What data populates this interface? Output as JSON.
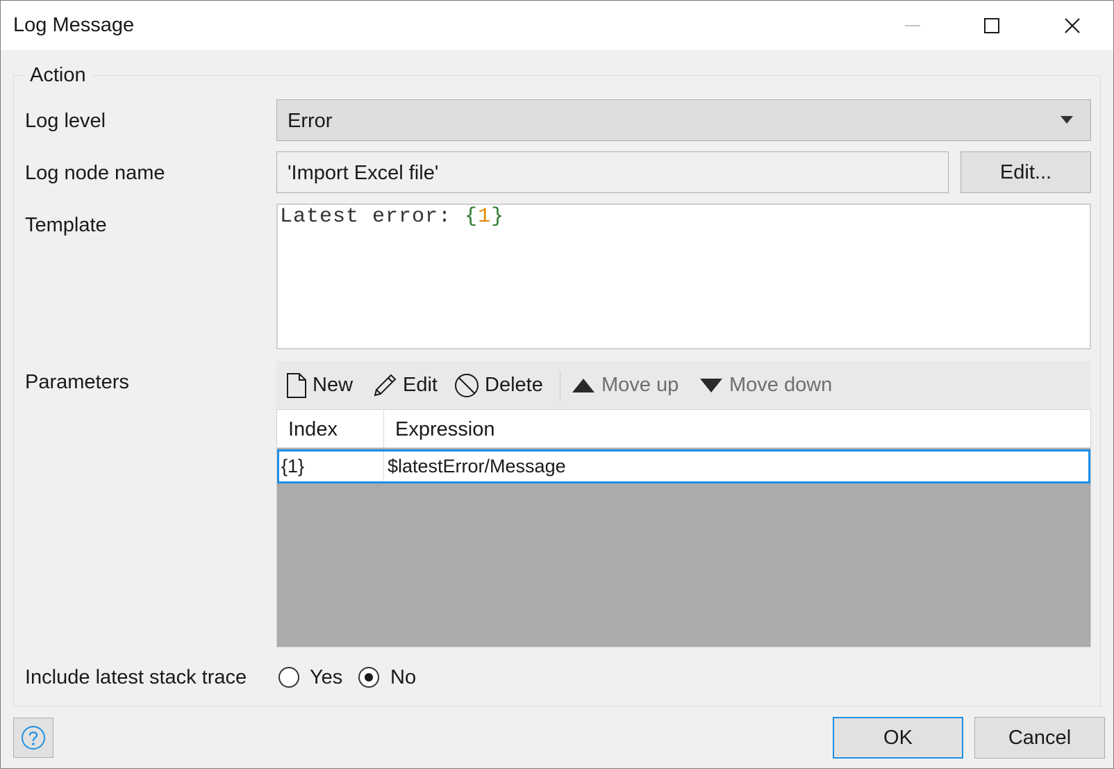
{
  "window": {
    "title": "Log Message"
  },
  "action_group": {
    "legend": "Action"
  },
  "log_level": {
    "label": "Log level",
    "value": "Error"
  },
  "log_node": {
    "label": "Log node name",
    "value": "'Import Excel file'",
    "edit_label": "Edit..."
  },
  "template": {
    "label": "Template",
    "text_prefix": "Latest error: ",
    "open_brace": "{",
    "param_index": "1",
    "close_brace": "}"
  },
  "parameters": {
    "label": "Parameters",
    "toolbar": {
      "new_label": "New",
      "edit_label": "Edit",
      "delete_label": "Delete",
      "move_up_label": "Move up",
      "move_down_label": "Move down"
    },
    "columns": {
      "index": "Index",
      "expression": "Expression"
    },
    "rows": [
      {
        "index": "{1}",
        "expression": "$latestError/Message"
      }
    ]
  },
  "stack_trace": {
    "label": "Include latest stack trace",
    "yes_label": "Yes",
    "no_label": "No",
    "selected": "No"
  },
  "footer": {
    "ok_label": "OK",
    "cancel_label": "Cancel"
  },
  "colors": {
    "accent": "#1e90e6",
    "brace": "#2e7d32",
    "number": "#e08a00"
  },
  "icons": {
    "minimize": "minimize-icon",
    "maximize": "maximize-icon",
    "close": "close-icon",
    "dropdown": "chevron-down-icon",
    "new": "document-icon",
    "edit": "pencil-icon",
    "delete": "prohibited-icon",
    "move_up": "triangle-up-icon",
    "move_down": "triangle-down-icon",
    "help": "help-icon"
  }
}
